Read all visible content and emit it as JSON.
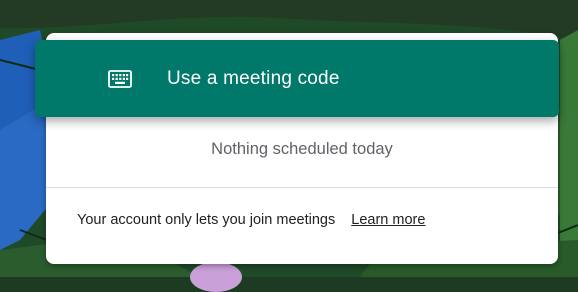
{
  "meeting_code": {
    "label": "Use a meeting code",
    "icon": "keyboard-icon"
  },
  "schedule": {
    "empty_text": "Nothing scheduled today"
  },
  "account_notice": {
    "text": "Your account only lets you join meetings",
    "link_label": "Learn more"
  },
  "colors": {
    "accent": "#00796b",
    "card": "#ffffff",
    "secondary_text": "#5f6368"
  }
}
